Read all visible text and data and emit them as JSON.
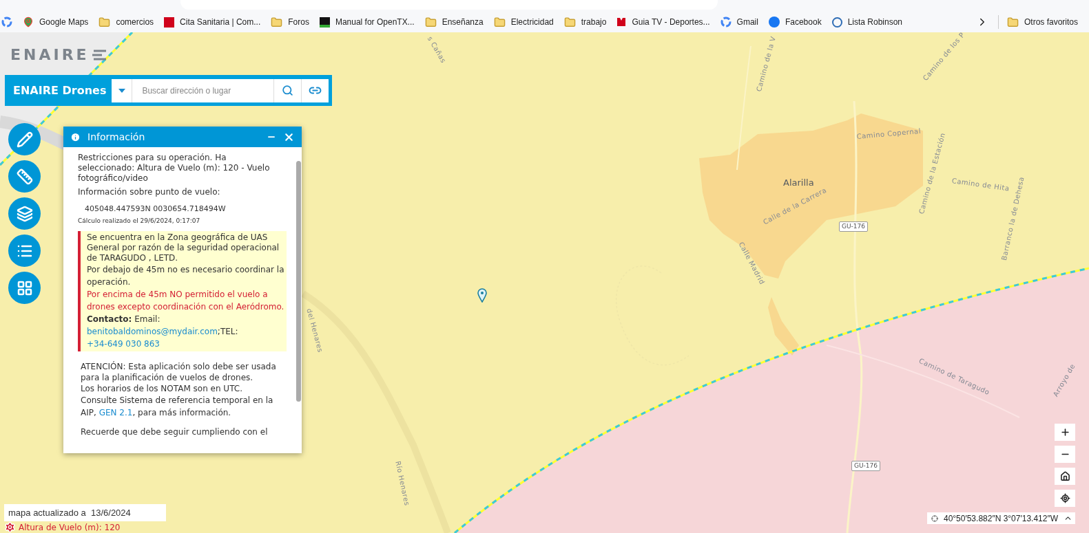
{
  "bookmarks": [
    {
      "label": "Google Maps"
    },
    {
      "label": "comercios"
    },
    {
      "label": "Cita Sanitaria | Com..."
    },
    {
      "label": "Foros"
    },
    {
      "label": "Manual for OpenTX..."
    },
    {
      "label": "Enseñanza"
    },
    {
      "label": "Electricidad"
    },
    {
      "label": "trabajo"
    },
    {
      "label": "Guia TV - Deportes..."
    },
    {
      "label": "Gmail"
    },
    {
      "label": "Facebook"
    },
    {
      "label": "Lista Robinson"
    }
  ],
  "other_bookmarks": "Otros favoritos",
  "logo": "ENAIRE",
  "app_title": "ENAIRE Drones",
  "search": {
    "placeholder": "Buscar dirección o lugar"
  },
  "info_panel": {
    "title": "Información",
    "intro": "Restricciones para su operación. Ha seleccionado: Altura de Vuelo (m): 120 - Vuelo fotográfico/video",
    "point_label": "Información sobre punto de vuelo:",
    "point_coords": "405048.447593N 0030654.718494W",
    "calculated": "Cálculo realizado el 29/6/2024, 0:17:07",
    "alert": {
      "zone": "Se encuentra en la Zona geográfica de UAS General por razón de la seguridad operacional de TARAGUDO , LETD.",
      "below": "Por debajo de 45m no es necesario coordinar la operación.",
      "warning": "Por encima de 45m NO permitido el vuelo a drones excepto coordinación con el Aeródromo.",
      "contact_label": "Contacto:",
      "email_label": "Email:",
      "email": "benitobaldominos@mydair.com",
      "tel_label": ";TEL:",
      "tel": "+34-649 030 863"
    },
    "attention": "ATENCIÓN: Esta aplicación solo debe ser usada para la planificación de vuelos de drones.",
    "notam": "Los horarios de los NOTAM son en UTC.",
    "consult_before": "Consulte Sistema de referencia temporal en la AIP,",
    "consult_link": "GEN 2.1",
    "consult_after": ", para más información.",
    "reminder": "Recuerde que debe seguir cumpliendo con el"
  },
  "map_labels": [
    {
      "text": "Alarilla",
      "kind": "place"
    },
    {
      "text": "Camino Copernal",
      "kind": "road"
    },
    {
      "text": "Camino de Hita",
      "kind": "road"
    },
    {
      "text": "Camino de la Estación",
      "kind": "road"
    },
    {
      "text": "Calle de la Carrera",
      "kind": "road"
    },
    {
      "text": "Calle Madrid",
      "kind": "road"
    },
    {
      "text": "GU-176",
      "kind": "shield"
    },
    {
      "text": "GU-176",
      "kind": "shield"
    },
    {
      "text": "Camino de Taragudo",
      "kind": "road"
    },
    {
      "text": "Barranco la de Dehesa",
      "kind": "road"
    },
    {
      "text": "Camino de la V",
      "kind": "road"
    },
    {
      "text": "Camino de los P",
      "kind": "road"
    },
    {
      "text": "Río Henares",
      "kind": "road"
    },
    {
      "text": "del Henares",
      "kind": "road"
    },
    {
      "text": "Arroyo de",
      "kind": "road"
    },
    {
      "text": "s Cañas",
      "kind": "road"
    }
  ],
  "map_updated": "mapa actualizado a  13/6/2024",
  "flight_height": "Altura de Vuelo (m): 120",
  "cursor_coords": "40°50′53.882″N 3°07′13.412″W"
}
